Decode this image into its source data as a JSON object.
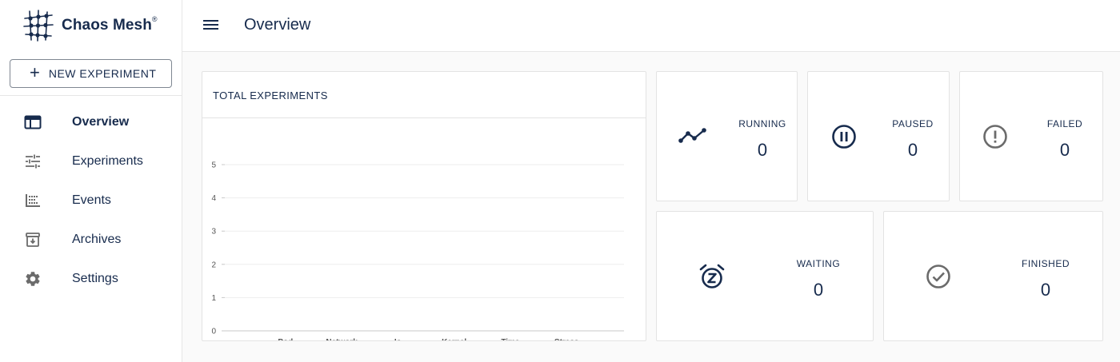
{
  "app": {
    "name": "Chaos Mesh",
    "trademark": "®"
  },
  "sidebar": {
    "new_experiment_label": "NEW EXPERIMENT",
    "items": [
      {
        "label": "Overview",
        "icon": "web-icon",
        "active": true
      },
      {
        "label": "Experiments",
        "icon": "tune-icon",
        "active": false
      },
      {
        "label": "Events",
        "icon": "timeline-icon",
        "active": false
      },
      {
        "label": "Archives",
        "icon": "archive-icon",
        "active": false
      },
      {
        "label": "Settings",
        "icon": "gear-icon",
        "active": false
      }
    ]
  },
  "header": {
    "title": "Overview"
  },
  "total_card": {
    "title": "TOTAL EXPERIMENTS"
  },
  "stats": {
    "running": {
      "label": "RUNNING",
      "value": "0",
      "icon": "trending-icon"
    },
    "paused": {
      "label": "PAUSED",
      "value": "0",
      "icon": "pause-icon"
    },
    "failed": {
      "label": "FAILED",
      "value": "0",
      "icon": "error-icon"
    },
    "waiting": {
      "label": "WAITING",
      "value": "0",
      "icon": "snooze-icon"
    },
    "finished": {
      "label": "FINISHED",
      "value": "0",
      "icon": "check-icon"
    }
  },
  "colors": {
    "primary_text": "#172b4d",
    "icon_gray": "#6b6b6b"
  },
  "chart_data": {
    "type": "bar",
    "categories": [
      "Pod",
      "Network",
      "Io",
      "Kernel",
      "Time",
      "Stress"
    ],
    "values": [
      0,
      0,
      0,
      0,
      0,
      0
    ],
    "yticks": [
      0,
      1,
      2,
      3,
      4,
      5
    ],
    "ylim": [
      0,
      5
    ],
    "grid": true
  }
}
